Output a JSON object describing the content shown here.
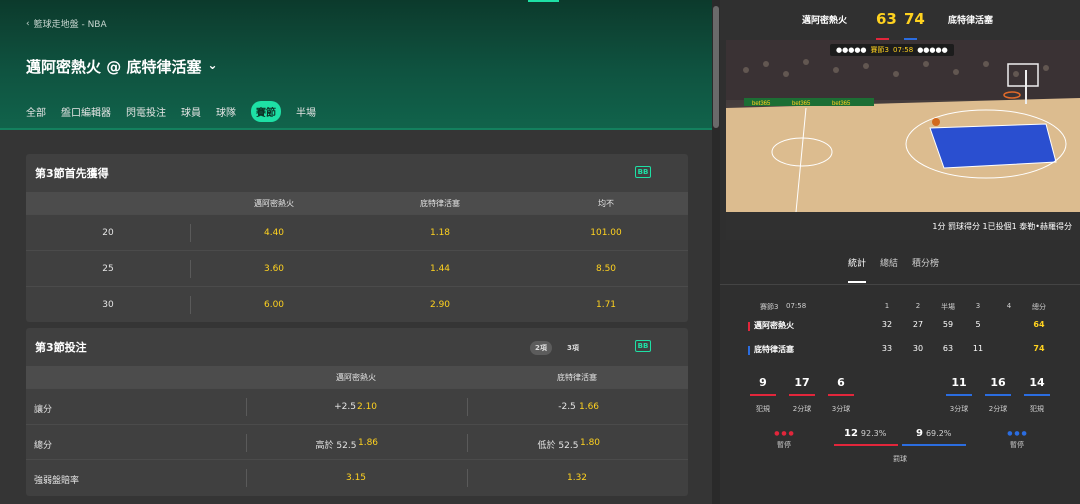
{
  "header": {
    "breadcrumb_arrow": "‹",
    "breadcrumb": "籃球走地盤 - NBA",
    "title": "邁阿密熱火 @ 底特律活塞",
    "title_chevron": "⌄",
    "tabs": [
      "全部",
      "盤口編輯器",
      "閃電投注",
      "球員",
      "球隊",
      "賽節",
      "半場"
    ],
    "active_tab": "賽節"
  },
  "market1": {
    "title": "第3節首先獲得",
    "badge": "BB",
    "columns": [
      "邁阿密熱火",
      "底特律活塞",
      "均不"
    ],
    "rows": [
      {
        "line": "20",
        "odds": [
          "4.40",
          "1.18",
          "101.00"
        ]
      },
      {
        "line": "25",
        "odds": [
          "3.60",
          "1.44",
          "8.50"
        ]
      },
      {
        "line": "30",
        "odds": [
          "6.00",
          "2.90",
          "1.71"
        ]
      }
    ]
  },
  "market2": {
    "title": "第3節投注",
    "pill_two": "2項",
    "pill_three": "3項",
    "badge": "BB",
    "columns": [
      "邁阿密熱火",
      "底特律活塞"
    ],
    "rows": [
      {
        "label": "讓分",
        "home_line": "+2.5",
        "home_odds": "2.10",
        "away_line": "-2.5",
        "away_odds": "1.66"
      },
      {
        "label": "總分",
        "home_line": "高於 52.5",
        "home_odds": "1.86",
        "away_line": "低於 52.5",
        "away_odds": "1.80"
      },
      {
        "label": "強弱盤賠率",
        "home_line": "",
        "home_odds": "3.15",
        "away_line": "",
        "away_odds": "1.32"
      }
    ]
  },
  "scoreboard": {
    "home": "邁阿密熱火",
    "home_score": "63",
    "away_score": "74",
    "away": "底特律活塞",
    "home_color": "#e2263b",
    "away_color": "#2b6de0"
  },
  "court": {
    "dots_left": "●●●●●",
    "period": "賽節3",
    "clock": "07:58",
    "dots_right": "●●●●●",
    "ad": "bet365",
    "caption": "1分  罰球得分 1已投個1 泰勒•赫羅得分"
  },
  "right_tabs": [
    "統計",
    "總結",
    "積分榜"
  ],
  "stats": {
    "period_label": "賽節3",
    "clock": "07:58",
    "headers": [
      "1",
      "2",
      "半場",
      "3",
      "4",
      "總分"
    ],
    "teams": [
      {
        "name": "邁阿密熱火",
        "scores": [
          "32",
          "27",
          "59",
          "5",
          "",
          "64"
        ]
      },
      {
        "name": "底特律活塞",
        "scores": [
          "33",
          "30",
          "63",
          "11",
          "",
          "74"
        ]
      }
    ],
    "home_counts": [
      {
        "value": "9",
        "label": "犯規"
      },
      {
        "value": "17",
        "label": "2分球"
      },
      {
        "value": "6",
        "label": "3分球"
      }
    ],
    "away_counts": [
      {
        "value": "11",
        "label": "3分球"
      },
      {
        "value": "16",
        "label": "2分球"
      },
      {
        "value": "14",
        "label": "犯規"
      }
    ],
    "timeout_label_home": "暫停",
    "timeout_label_away": "暫停",
    "ft_home": "12",
    "ft_home_pct": "92.3%",
    "ft_away": "9",
    "ft_away_pct": "69.2%",
    "ft_label": "罰球"
  }
}
